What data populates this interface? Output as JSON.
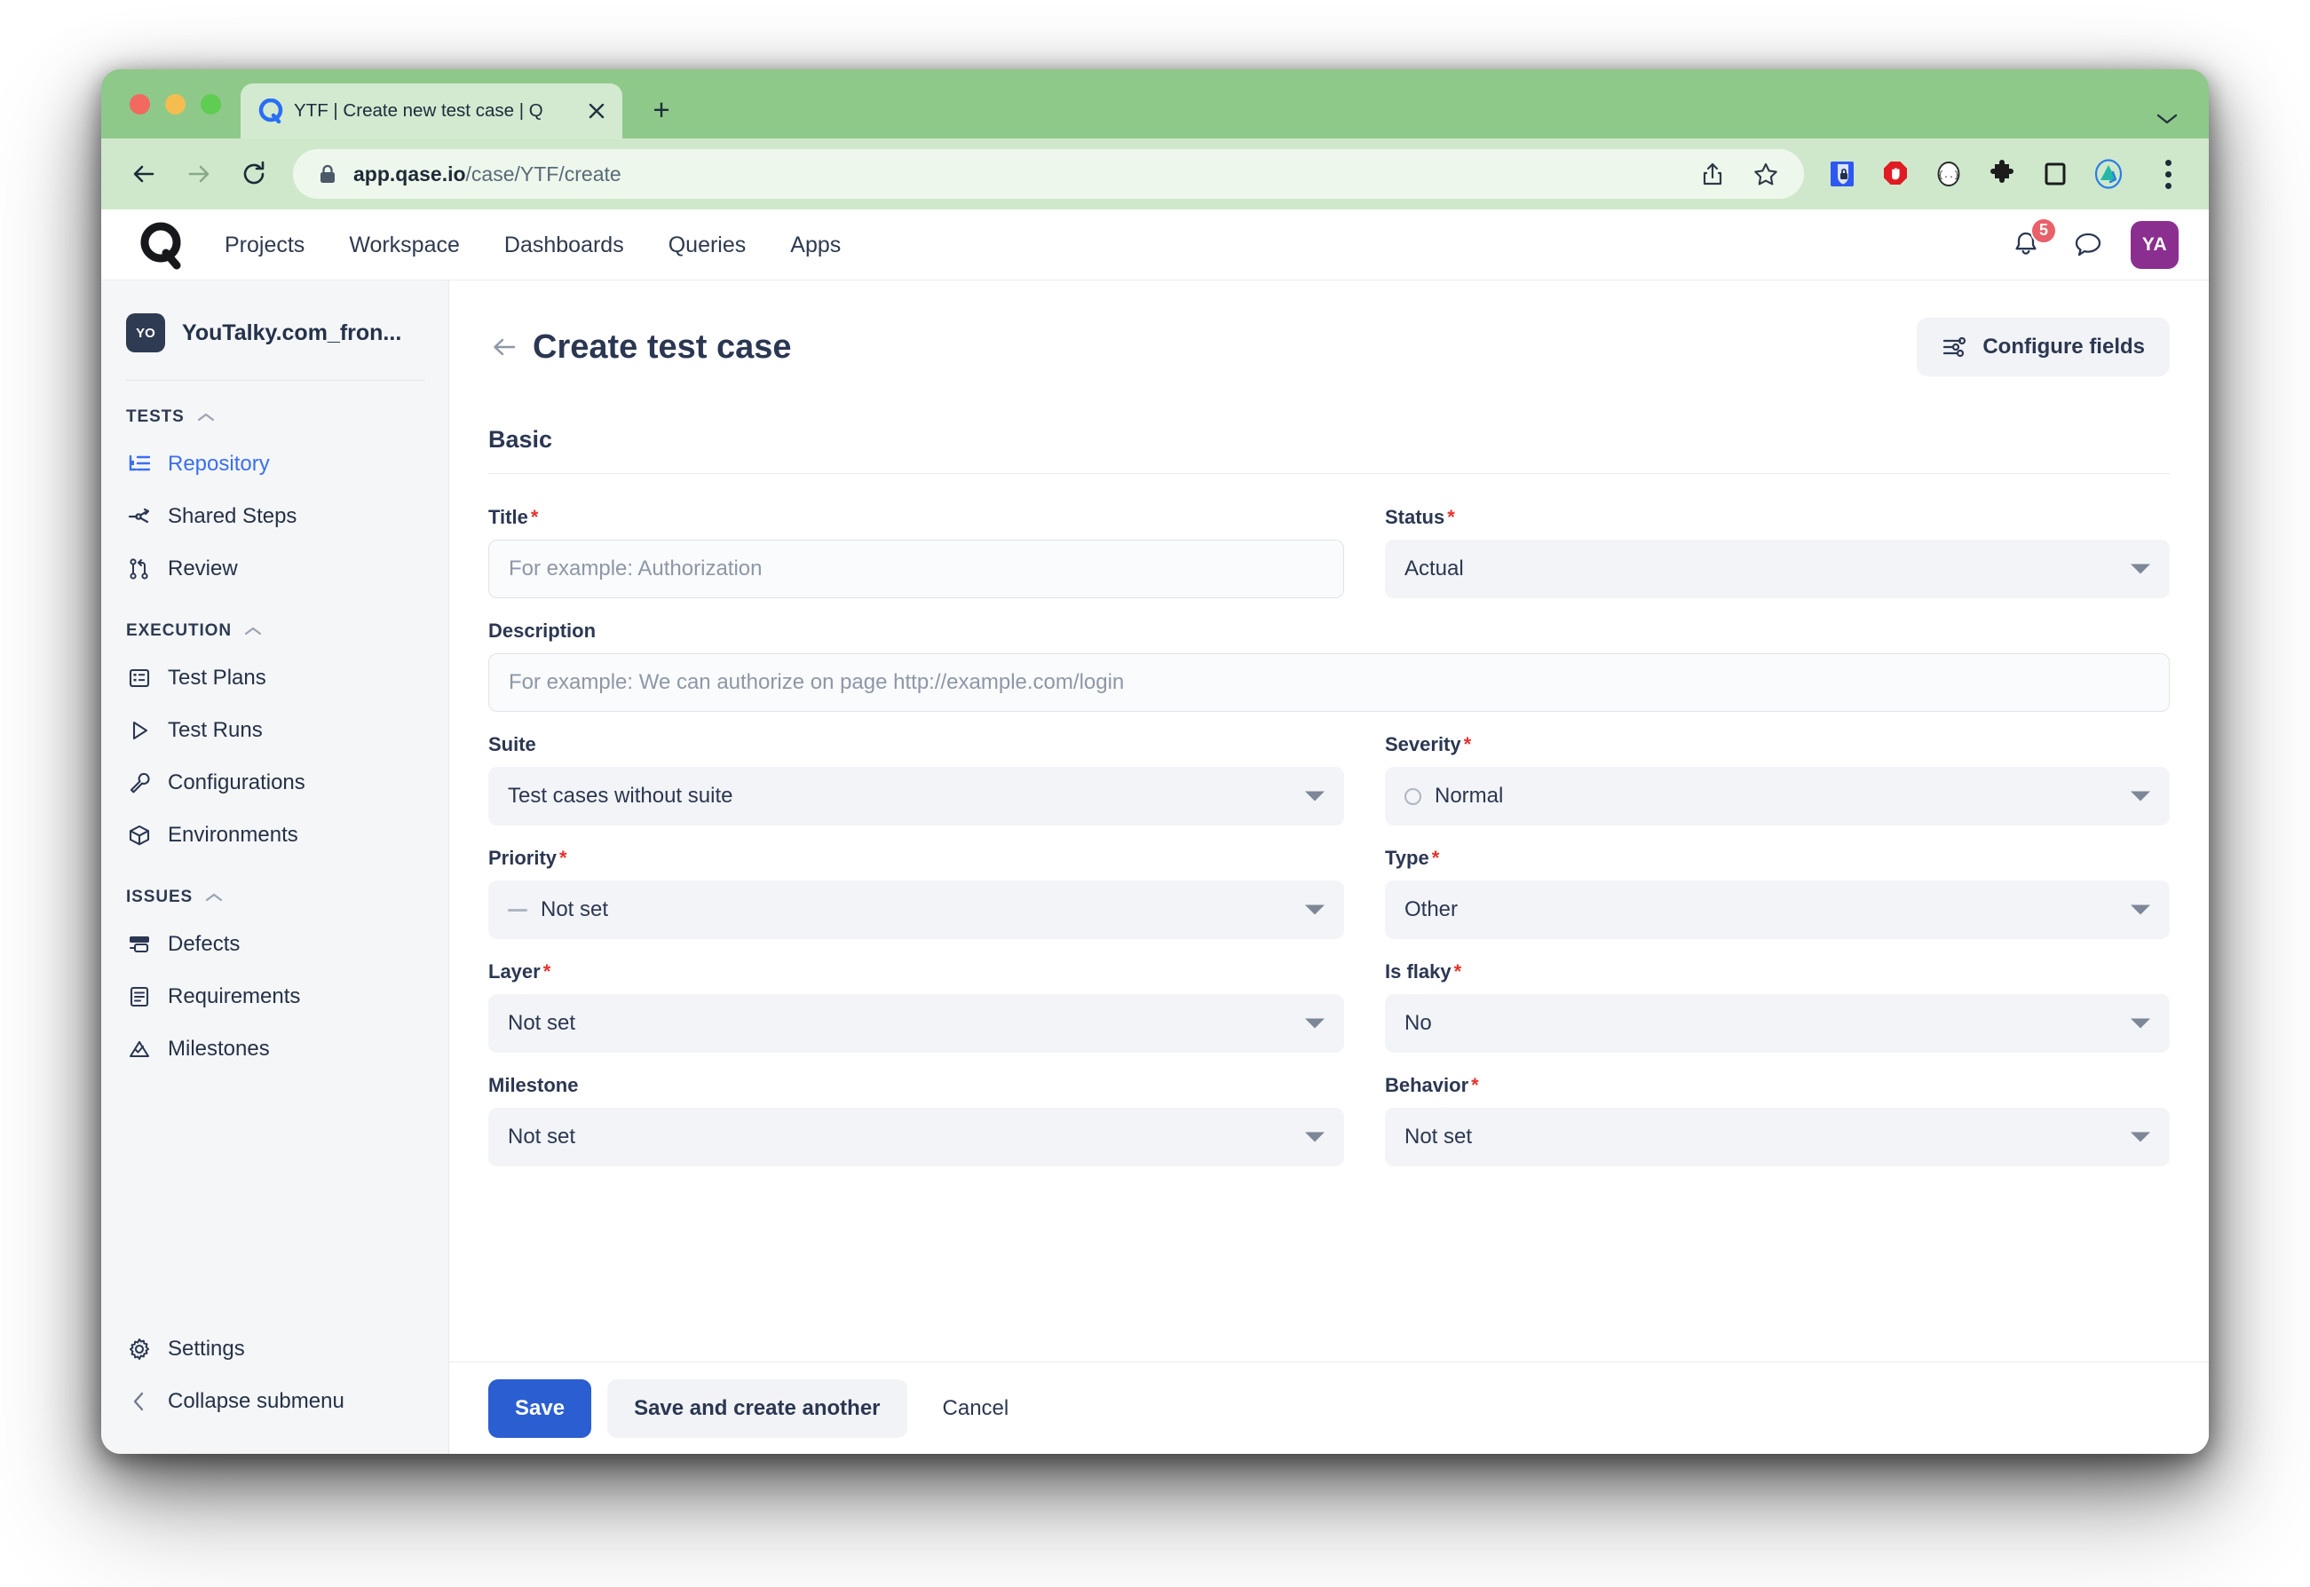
{
  "browser": {
    "tab": {
      "title": "YTF | Create new test case | Q",
      "favicon": "qase-logo-icon"
    },
    "new_tab_label": "+",
    "url_host": "app.qase.io",
    "url_path": "/case/YTF/create",
    "toolbar_icons": [
      "share-icon",
      "bookmark-star-icon",
      "password-manager-icon",
      "adblock-icon",
      "json-viewer-icon",
      "extensions-puzzle-icon",
      "side-panel-icon",
      "profile-extension-icon",
      "chrome-menu-icon"
    ]
  },
  "appnav": {
    "brand": "qase-logo",
    "links": [
      "Projects",
      "Workspace",
      "Dashboards",
      "Queries",
      "Apps"
    ],
    "notifications_count": "5",
    "avatar_initials": "YA"
  },
  "sidebar": {
    "project": {
      "badge": "YO",
      "name": "YouTalky.com_fron..."
    },
    "groups": [
      {
        "title": "TESTS",
        "items": [
          {
            "label": "Repository",
            "icon": "repository-icon",
            "active": true
          },
          {
            "label": "Shared Steps",
            "icon": "shared-steps-icon",
            "active": false
          },
          {
            "label": "Review",
            "icon": "review-icon",
            "active": false
          }
        ]
      },
      {
        "title": "EXECUTION",
        "items": [
          {
            "label": "Test Plans",
            "icon": "test-plans-icon",
            "active": false
          },
          {
            "label": "Test Runs",
            "icon": "test-runs-icon",
            "active": false
          },
          {
            "label": "Configurations",
            "icon": "configurations-icon",
            "active": false
          },
          {
            "label": "Environments",
            "icon": "environments-icon",
            "active": false
          }
        ]
      },
      {
        "title": "ISSUES",
        "items": [
          {
            "label": "Defects",
            "icon": "defects-icon",
            "active": false
          },
          {
            "label": "Requirements",
            "icon": "requirements-icon",
            "active": false
          },
          {
            "label": "Milestones",
            "icon": "milestones-icon",
            "active": false
          }
        ]
      }
    ],
    "settings_label": "Settings",
    "collapse_label": "Collapse submenu"
  },
  "page": {
    "title": "Create test case",
    "configure_fields_label": "Configure fields",
    "section_basic": "Basic"
  },
  "form": {
    "title": {
      "label": "Title",
      "required": "*",
      "placeholder": "For example: Authorization",
      "value": ""
    },
    "status": {
      "label": "Status",
      "required": "*",
      "value": "Actual"
    },
    "description": {
      "label": "Description",
      "placeholder": "For example: We can authorize on page http://example.com/login",
      "value": ""
    },
    "suite": {
      "label": "Suite",
      "value": "Test cases without suite"
    },
    "severity": {
      "label": "Severity",
      "required": "*",
      "value": "Normal"
    },
    "priority": {
      "label": "Priority",
      "required": "*",
      "value": "Not set"
    },
    "type": {
      "label": "Type",
      "required": "*",
      "value": "Other"
    },
    "layer": {
      "label": "Layer",
      "required": "*",
      "value": "Not set"
    },
    "is_flaky": {
      "label": "Is flaky",
      "required": "*",
      "value": "No"
    },
    "milestone": {
      "label": "Milestone",
      "value": "Not set"
    },
    "behavior": {
      "label": "Behavior",
      "required": "*",
      "value": "Not set"
    }
  },
  "footer": {
    "save": "Save",
    "save_another": "Save and create another",
    "cancel": "Cancel"
  },
  "colors": {
    "primary": "#2a5ed1",
    "accent_link": "#3b6ef0",
    "required": "#e5322d",
    "avatar": "#8a2f8f",
    "badge": "#e8606a",
    "browser_chrome": "#8ec98a"
  }
}
